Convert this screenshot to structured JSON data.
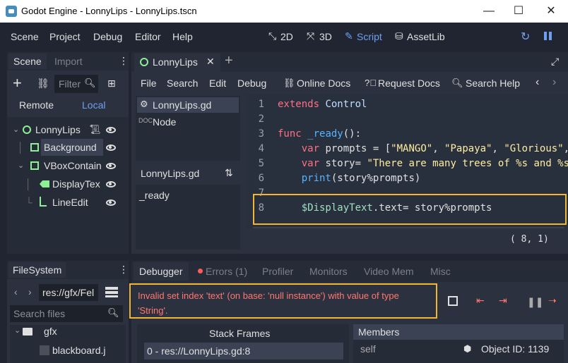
{
  "window": {
    "title": "Godot Engine - LonnyLips - LonnyLips.tscn",
    "minimize": "—",
    "maximize": "☐",
    "close": "✕"
  },
  "menu": {
    "items": [
      "Scene",
      "Project",
      "Debug",
      "Editor",
      "Help"
    ]
  },
  "workspaces": {
    "items": [
      "2D",
      "3D",
      "Script",
      "AssetLib"
    ],
    "active": "Script"
  },
  "scene_dock": {
    "tabs": [
      "Scene",
      "Import"
    ],
    "filter_placeholder": "Filter",
    "remote": "Remote",
    "local": "Local",
    "nodes": [
      "LonnyLips",
      "Background",
      "VBoxContain",
      "DisplayTex",
      "LineEdit"
    ]
  },
  "script_tabs": {
    "current": "LonnyLips",
    "add": "+"
  },
  "script_menu": {
    "items": [
      "File",
      "Search",
      "Edit",
      "Debug"
    ],
    "online_docs": "Online Docs",
    "request_docs": "Request Docs",
    "search_help": "Search Help"
  },
  "script_list": {
    "items": [
      "LonnyLips.gd",
      "Node"
    ],
    "method_header": "LonnyLips.gd",
    "methods": [
      "_ready"
    ]
  },
  "code": {
    "lines": [
      {
        "num": "1",
        "parts": [
          [
            "kw",
            "extends"
          ],
          [
            "tx",
            " "
          ],
          [
            "ty",
            "Control"
          ]
        ]
      },
      {
        "num": "2",
        "parts": []
      },
      {
        "num": "3",
        "parts": [
          [
            "kw",
            "func"
          ],
          [
            "tx",
            " "
          ],
          [
            "fn",
            "_ready"
          ],
          [
            "tx",
            "():"
          ]
        ]
      },
      {
        "num": "4",
        "parts": [
          [
            "tx",
            "    "
          ],
          [
            "kw",
            "var"
          ],
          [
            "tx",
            " prompts = ["
          ],
          [
            "str",
            "\"MANGO\""
          ],
          [
            "tx",
            ", "
          ],
          [
            "str",
            "\"Papaya\""
          ],
          [
            "tx",
            ", "
          ],
          [
            "str",
            "\"Glorious\""
          ],
          [
            "tx",
            ","
          ]
        ]
      },
      {
        "num": "5",
        "parts": [
          [
            "tx",
            "    "
          ],
          [
            "kw",
            "var"
          ],
          [
            "tx",
            " story= "
          ],
          [
            "str",
            "\"There are many trees of %s and %s"
          ]
        ]
      },
      {
        "num": "6",
        "parts": [
          [
            "tx",
            "    "
          ],
          [
            "fn",
            "print"
          ],
          [
            "tx",
            "(story%prompts)"
          ]
        ]
      },
      {
        "num": "7",
        "parts": []
      },
      {
        "num": "8",
        "parts": [
          [
            "tx",
            "    "
          ],
          [
            "nm",
            "$DisplayText"
          ],
          [
            "tx",
            ".text= story%prompts"
          ]
        ]
      }
    ],
    "cursor": "( 8,  1)"
  },
  "filesystem": {
    "title": "FileSystem",
    "path": "res://gfx/Fel",
    "search_placeholder": "Search files",
    "folder": "gfx",
    "file": "blackboard.j"
  },
  "debugger": {
    "tabs": [
      "Debugger",
      "Errors (1)",
      "Profiler",
      "Monitors",
      "Video Mem",
      "Misc"
    ],
    "error_message": "Invalid set index 'text' (on base: 'null instance') with value of type 'String'.",
    "stack_frames_header": "Stack Frames",
    "stack_frame": "0 - res://LonnyLips.gd:8",
    "members_header": "Members",
    "member_name": "self",
    "member_value": "Object ID: 1139"
  },
  "colors": {
    "highlight": "#f2b731",
    "error": "#ff786b",
    "accent": "#6ea0f0"
  }
}
